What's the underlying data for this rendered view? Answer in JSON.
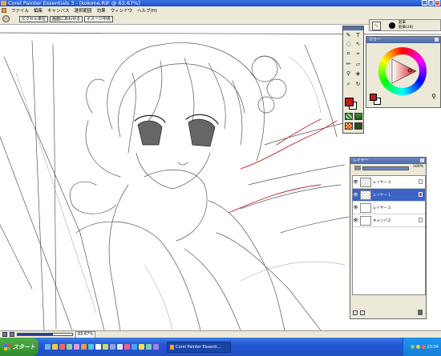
{
  "window": {
    "title": "Corel Painter Essentials 3 - [kokone.RIF @ 63.67%]",
    "controls": [
      "_",
      "□",
      "×"
    ]
  },
  "menubar": {
    "items": [
      "ファイル",
      "編集",
      "キャンバス",
      "選択範囲",
      "効果",
      "ウィンドウ",
      "ヘルプ(H)"
    ]
  },
  "propbar": {
    "buttons": [
      "ピクセル単位",
      "画面にあわせる",
      "イメージ中央"
    ]
  },
  "brush": {
    "category": "鉛筆",
    "variant": "鉛筆(2B)"
  },
  "color_panel": {
    "title": "カラー",
    "main_color": "#c01a1a",
    "second_color": "#ffffff"
  },
  "layers_panel": {
    "title": "レイヤー",
    "opacity": "100%",
    "opacity_fraction": 1.0,
    "layers": [
      {
        "name": "レイヤー 3",
        "selected": false
      },
      {
        "name": "レイヤー 1",
        "selected": true
      },
      {
        "name": "レイヤー 2",
        "selected": false
      },
      {
        "name": "キャンバス",
        "selected": false
      }
    ]
  },
  "statusbar": {
    "zoom": "63.67%",
    "zoom_fraction": 0.64
  },
  "taskbar": {
    "start_label": "スタート",
    "task_label": "Corel Painter Essenti...",
    "clock": "23:54"
  },
  "icons": [
    "app-icon",
    "hand-icon",
    "pencil-icon",
    "text-icon",
    "eyedropper-icon",
    "magnifier-icon",
    "eye-icon",
    "lock-icon",
    "trash-icon"
  ]
}
